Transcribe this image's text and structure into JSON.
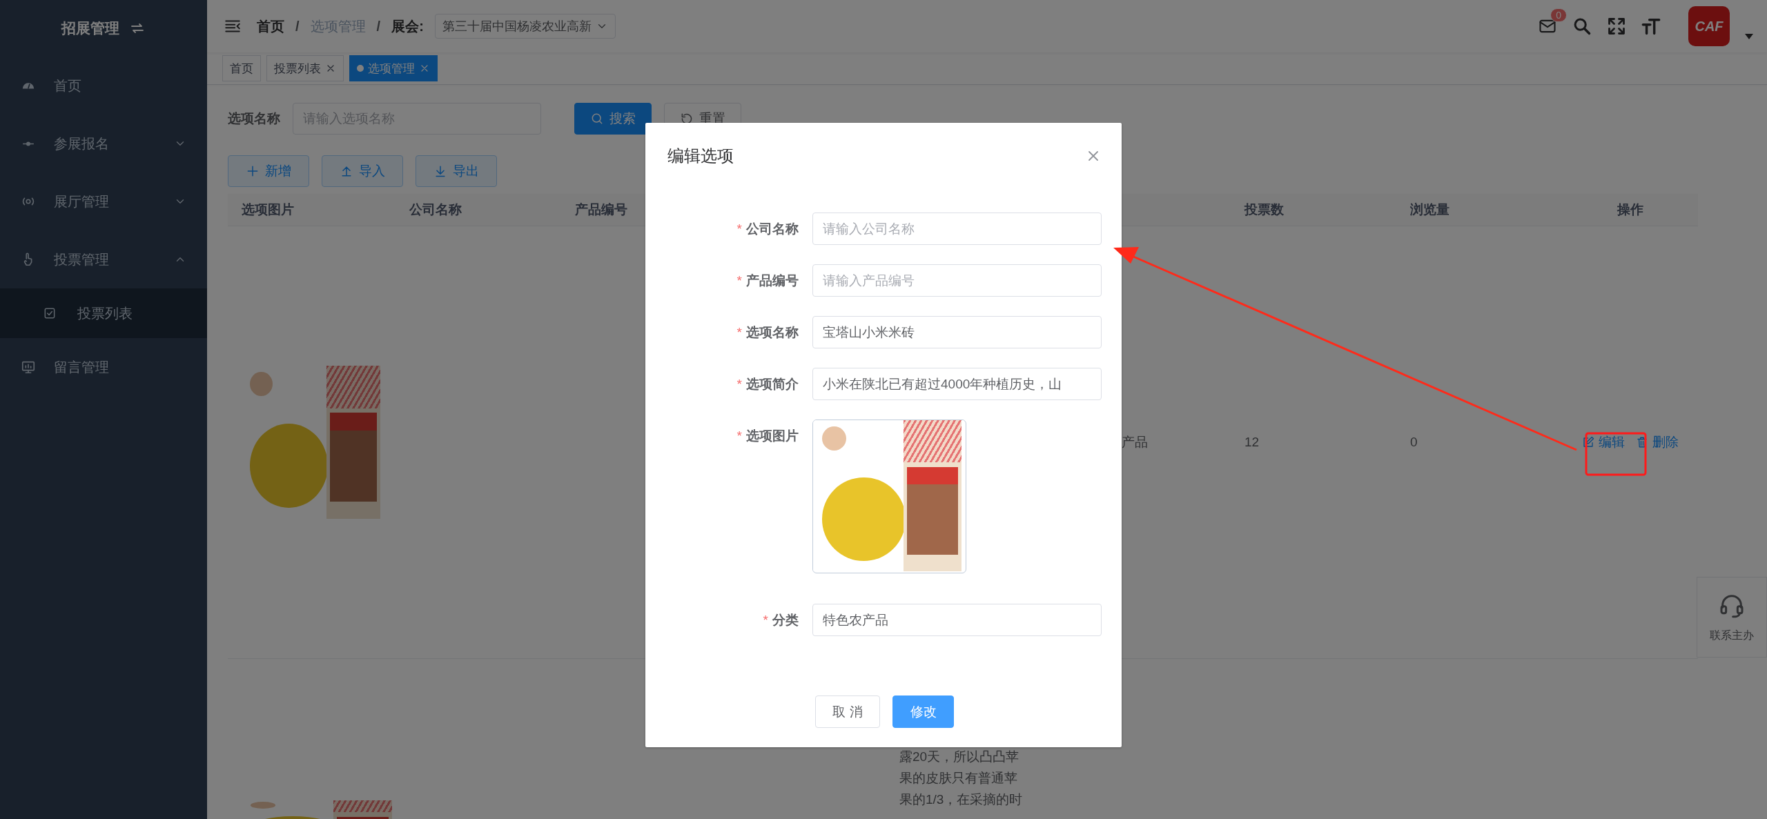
{
  "sidebar": {
    "title": "招展管理",
    "items": [
      {
        "label": "首页",
        "selected": false
      },
      {
        "label": "参展报名",
        "selected": false,
        "expanded": false
      },
      {
        "label": "展厅管理",
        "selected": false,
        "expanded": false
      },
      {
        "label": "投票管理",
        "selected": false,
        "expanded": true,
        "children": [
          {
            "label": "投票列表",
            "selected": true
          }
        ]
      },
      {
        "label": "留言管理",
        "selected": false
      }
    ]
  },
  "header": {
    "breadcrumb": [
      {
        "label": "首页",
        "current": false,
        "separator": "/"
      },
      {
        "label": "选项管理",
        "current": true,
        "separator": "/"
      },
      {
        "label": "展会:",
        "current": false
      }
    ],
    "exhibition_select": "第三十届中国杨凌农业高新",
    "mail_count": "0",
    "avatar_text": "CAF"
  },
  "tabs": [
    {
      "label": "首页",
      "selected": false,
      "closable": false
    },
    {
      "label": "投票列表",
      "selected": false,
      "closable": true
    },
    {
      "label": "选项管理",
      "selected": true,
      "closable": true
    }
  ],
  "search": {
    "label": "选项名称",
    "placeholder": "请输入选项名称",
    "buttons": [
      {
        "label": "搜索",
        "primary": true
      },
      {
        "label": "重置",
        "primary": false
      }
    ]
  },
  "toolbar": [
    "新增",
    "导入",
    "导出"
  ],
  "table": {
    "columns": [
      "选项图片",
      "公司名称",
      "产品编号",
      "投票数",
      "浏览量",
      "操作"
    ],
    "rows": [
      {
        "category": "产品",
        "votes": "12",
        "views": "0",
        "actions": [
          "编辑",
          "删除"
        ]
      },
      {
        "description_lines": [
          "露20天，所以凸凸苹",
          "果的皮肤只有普通苹",
          "果的1/3，在采摘的时"
        ]
      }
    ]
  },
  "contact": {
    "label": "联系主办"
  },
  "modal": {
    "title": "编辑选项",
    "fields": [
      {
        "kind": "text",
        "label": "公司名称",
        "required_mark": "*",
        "placeholder": "请输入公司名称"
      },
      {
        "kind": "text",
        "label": "产品编号",
        "required_mark": "*",
        "placeholder": "请输入产品编号"
      },
      {
        "kind": "text",
        "label": "选项名称",
        "required_mark": "*",
        "value": "宝塔山小米米砖"
      },
      {
        "kind": "text",
        "label": "选项简介",
        "required_mark": "*",
        "value": "小米在陕北已有超过4000年种植历史，山"
      },
      {
        "kind": "image",
        "label": "选项图片",
        "required_mark": "*"
      },
      {
        "kind": "text",
        "label": "分类",
        "required_mark": "*",
        "value": "特色农产品"
      }
    ],
    "buttons": [
      {
        "label": "取 消",
        "primary": false
      },
      {
        "label": "修改",
        "primary": true
      }
    ]
  }
}
